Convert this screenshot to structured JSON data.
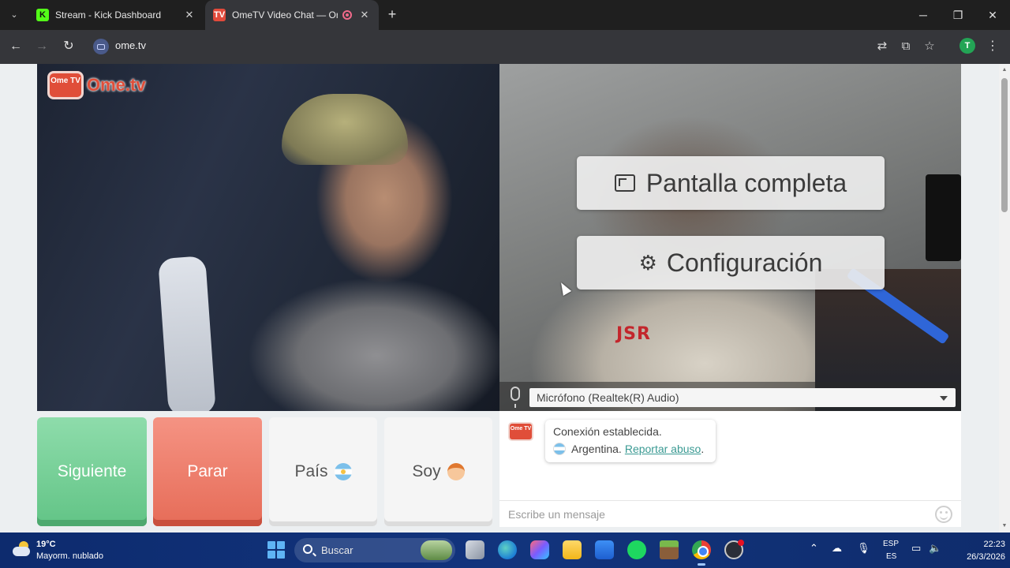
{
  "browser": {
    "tabs": [
      {
        "title": "Stream - Kick Dashboard",
        "favicon": "kick-icon"
      },
      {
        "title": "OmeTV Video Chat — Ome",
        "favicon": "ometv-icon",
        "recording": true
      }
    ],
    "url": "ome.tv"
  },
  "app": {
    "logo_tv": "Ome TV",
    "logo_brand": "Ome.tv",
    "overlay": {
      "fullscreen_label": "Pantalla completa",
      "settings_label": "Configuración"
    },
    "watermark": "JSR",
    "microphone": "Micrófono (Realtek(R) Audio)",
    "buttons": {
      "next": "Siguiente",
      "stop": "Parar",
      "country": "País",
      "soy": "Soy"
    },
    "chat": {
      "status": "Conexión establecida.",
      "country": "Argentina.",
      "report": "Reportar abuso",
      "report_suffix": ".",
      "placeholder": "Escribe un mensaje"
    },
    "colors": {
      "next": "#62c486",
      "stop": "#e66c58",
      "brand": "#e04e39",
      "link": "#3a9a93"
    }
  },
  "taskbar": {
    "weather_temp": "19°C",
    "weather_desc": "Mayorm. nublado",
    "search_label": "Buscar",
    "lang_top": "ESP",
    "lang_bottom": "ES",
    "time": "22:23",
    "date": "26/3/2026"
  }
}
